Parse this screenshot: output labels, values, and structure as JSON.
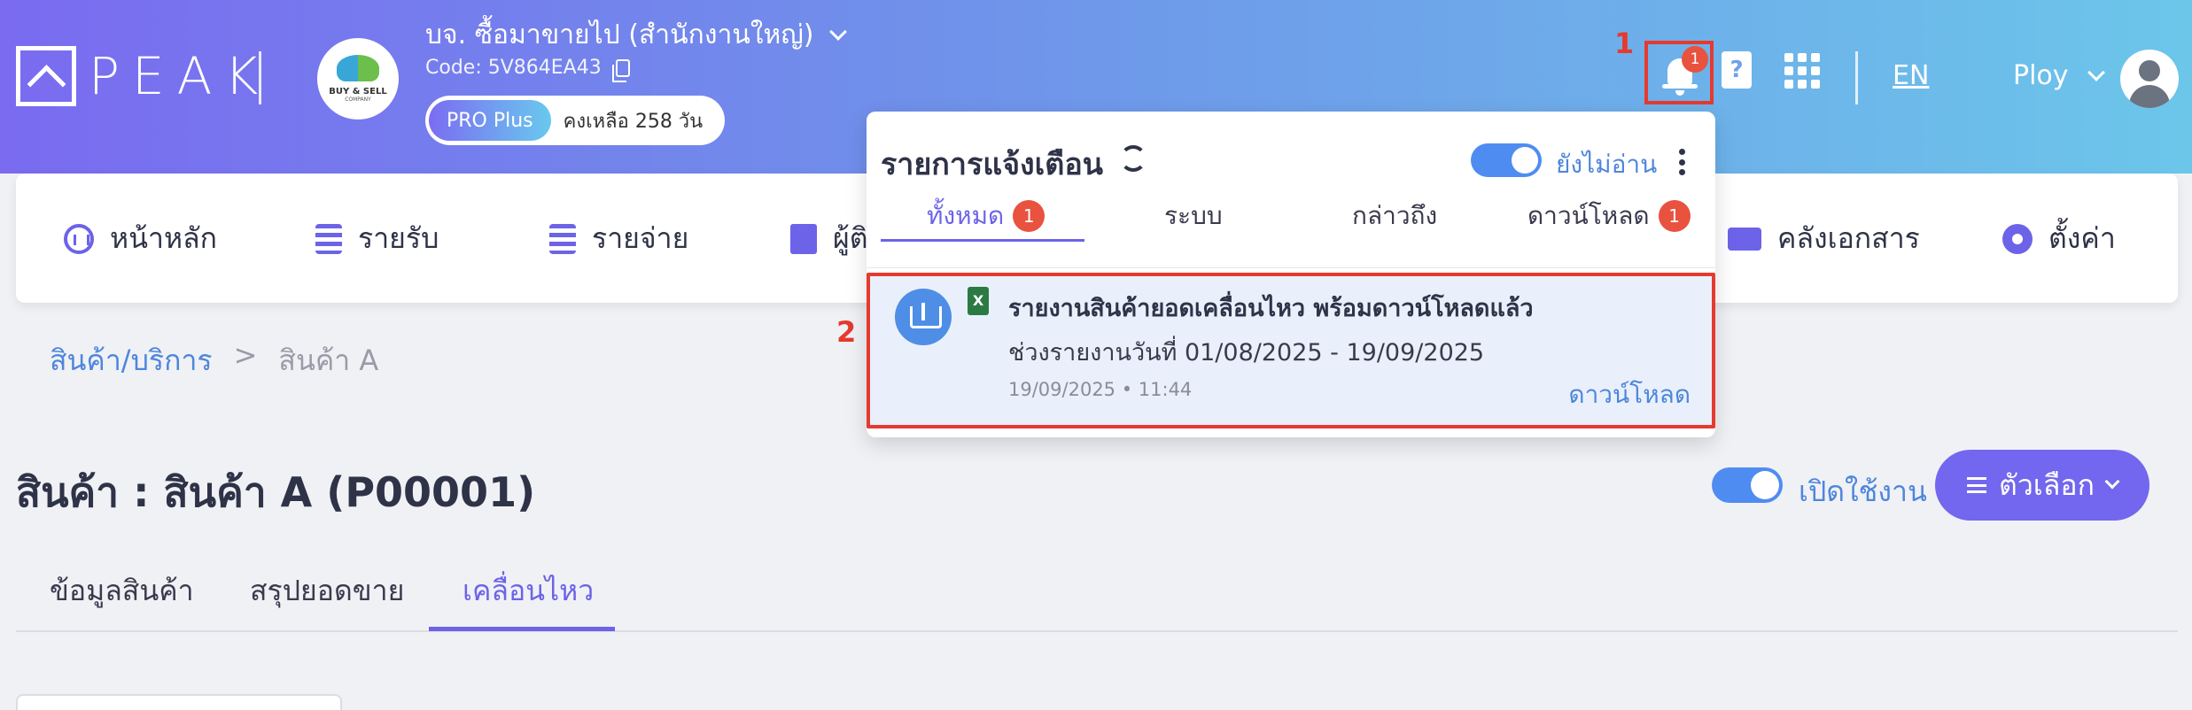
{
  "brand": {
    "logo_text": "PEAK"
  },
  "company": {
    "name": "บจ. ซื้อมาขายไป (สำนักงานใหญ่)",
    "code": "Code: 5V864EA43",
    "logo_text": "BUY & SELL",
    "logo_sub": "COMPANY",
    "plan": "PRO Plus",
    "days_left": "คงเหลือ 258 วัน"
  },
  "header": {
    "notification_count": "1",
    "help_glyph": "?",
    "language": "EN",
    "user_name": "Ploy"
  },
  "annotations": {
    "marker_1": "1",
    "marker_2": "2"
  },
  "nav": {
    "items": [
      {
        "label": "หน้าหลัก",
        "icon": "dashboard-icon"
      },
      {
        "label": "รายรับ",
        "icon": "income-coins-icon"
      },
      {
        "label": "รายจ่าย",
        "icon": "expense-coins-icon"
      },
      {
        "label": "ผู้ติ",
        "icon": "contacts-building-icon"
      },
      {
        "label": "คลังเอกสาร",
        "icon": "folder-icon"
      },
      {
        "label": "ตั้งค่า",
        "icon": "gear-icon"
      }
    ]
  },
  "breadcrumb": {
    "parent": "สินค้า/บริการ",
    "separator": ">",
    "current": "สินค้า A"
  },
  "page": {
    "title": "สินค้า : สินค้า A (P00001)",
    "active_label": "เปิดใช้งาน",
    "options_label": "ตัวเลือก",
    "tabs": [
      "ข้อมูลสินค้า",
      "สรุปยอดขาย",
      "เคลื่อนไหว"
    ],
    "active_tab": "เคลื่อนไหว"
  },
  "notifications": {
    "title": "รายการแจ้งเตือน",
    "unread_label": "ยังไม่อ่าน",
    "unread_toggle_on": true,
    "tabs": [
      {
        "label": "ทั้งหมด",
        "badge": "1"
      },
      {
        "label": "ระบบ",
        "badge": ""
      },
      {
        "label": "กล่าวถึง",
        "badge": ""
      },
      {
        "label": "ดาวน์โหลด",
        "badge": "1"
      }
    ],
    "item": {
      "file_glyph": "X",
      "heading": "รายงานสินค้ายอดเคลื่อนไหว พร้อมดาวน์โหลดแล้ว",
      "subtitle": "ช่วงรายงานวันที่ 01/08/2025 - 19/09/2025",
      "timestamp": "19/09/2025 • 11:44",
      "action": "ดาวน์โหลด"
    }
  },
  "colors": {
    "accent": "#6c63e8",
    "link": "#4e86dc",
    "alert": "#e53a2f"
  }
}
